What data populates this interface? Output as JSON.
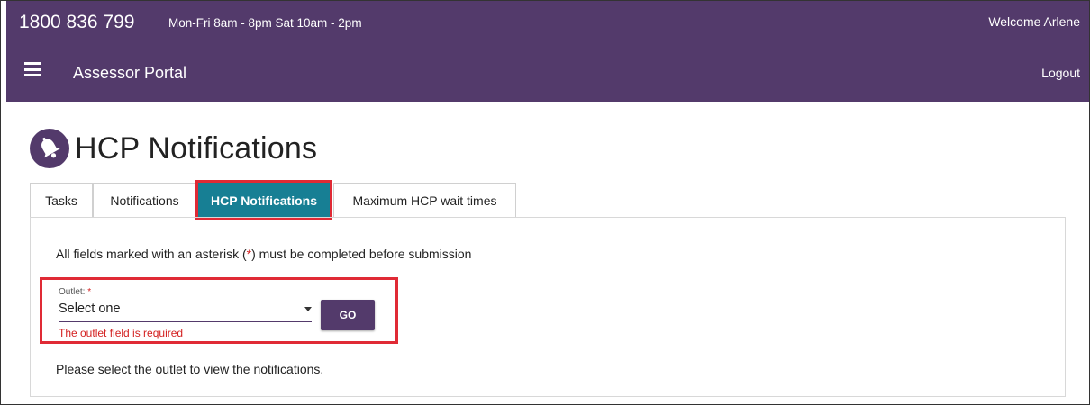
{
  "header": {
    "phone": "1800 836 799",
    "hours": "Mon-Fri 8am - 8pm Sat 10am - 2pm",
    "welcome": "Welcome Arlene",
    "portal_title": "Assessor Portal",
    "logout_label": "Logout",
    "menu_icon": "hamburger-menu-icon",
    "background_color": "#533a6b"
  },
  "page": {
    "title": "HCP Notifications",
    "title_icon": "bell-icon"
  },
  "tabs": [
    {
      "label": "Tasks"
    },
    {
      "label": "Notifications"
    },
    {
      "label": "HCP Notifications",
      "active": true
    },
    {
      "label": "Maximum HCP wait times"
    }
  ],
  "form": {
    "instructions_prefix": "All fields marked with an asterisk (",
    "instructions_asterisk": "*",
    "instructions_suffix": ") must be completed before submission",
    "outlet_label": "Outlet:",
    "required_marker": "*",
    "outlet_value": "Select one",
    "outlet_error": "The outlet field is required",
    "go_label": "GO",
    "hint": "Please select the outlet to view the notifications."
  },
  "colors": {
    "accent": "#533a6b",
    "active_tab": "#177f94",
    "error": "#d32121",
    "highlight": "#e02a35"
  }
}
